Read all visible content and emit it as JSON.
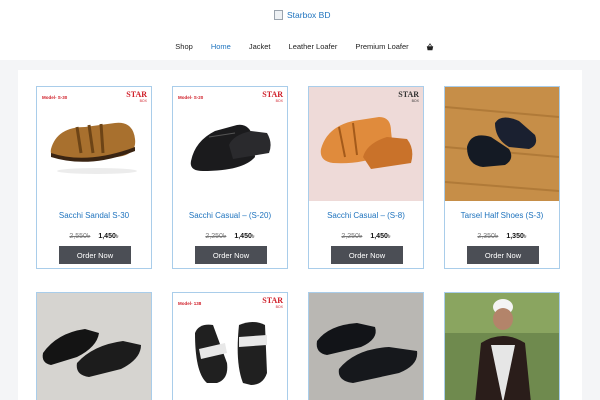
{
  "site": {
    "logo_text": "Starbox BD"
  },
  "nav": {
    "items": [
      {
        "label": "Shop"
      },
      {
        "label": "Home"
      },
      {
        "label": "Jacket"
      },
      {
        "label": "Leather Loafer"
      },
      {
        "label": "Premium Loafer"
      }
    ],
    "active": "Home"
  },
  "products_row1": [
    {
      "title": "Sacchi Sandal S-30",
      "old_price": "2,550৳",
      "new_price": "1,450",
      "currency": "৳",
      "button": "Order Now",
      "model_tag": "Model- S-30",
      "brand": "STAR",
      "brand_sub": "BOX"
    },
    {
      "title": "Sacchi Casual – (S-20)",
      "old_price": "2,250৳",
      "new_price": "1,450",
      "currency": "৳",
      "button": "Order Now",
      "model_tag": "Model- S-20",
      "brand": "STAR",
      "brand_sub": "BOX"
    },
    {
      "title": "Sacchi Casual – (S-8)",
      "old_price": "2,250৳",
      "new_price": "1,450",
      "currency": "৳",
      "button": "Order Now",
      "model_tag": "",
      "brand": "STAR",
      "brand_sub": "BOX"
    },
    {
      "title": "Tarsel Half Shoes (S-3)",
      "old_price": "2,350৳",
      "new_price": "1,350",
      "currency": "৳",
      "button": "Order Now",
      "model_tag": "",
      "brand": "",
      "brand_sub": ""
    }
  ],
  "products_row2": [
    {
      "model_tag": "",
      "brand": "",
      "brand_sub": ""
    },
    {
      "model_tag": "Model- 138",
      "brand": "STAR",
      "brand_sub": "BOX"
    },
    {
      "model_tag": "",
      "brand": "",
      "brand_sub": ""
    },
    {
      "model_tag": "",
      "brand": "",
      "brand_sub": ""
    }
  ],
  "colors": {
    "accent": "#1e73be",
    "button": "#4b4e55",
    "brand_red": "#d0202a",
    "card_border": "#a9cdea"
  }
}
